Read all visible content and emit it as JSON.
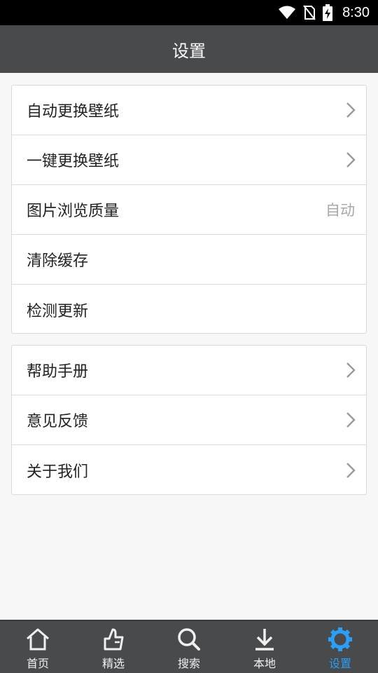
{
  "status_bar": {
    "time": "8:30",
    "icons": [
      "wifi-icon",
      "no-sim-icon",
      "battery-charging-icon"
    ]
  },
  "header": {
    "title": "设置"
  },
  "groups": [
    {
      "items": [
        {
          "label": "自动更换壁纸",
          "has_arrow": true
        },
        {
          "label": "一键更换壁纸",
          "has_arrow": true
        },
        {
          "label": "图片浏览质量",
          "value": "自动"
        },
        {
          "label": "清除缓存"
        },
        {
          "label": "检测更新"
        }
      ]
    },
    {
      "items": [
        {
          "label": "帮助手册",
          "has_arrow": true
        },
        {
          "label": "意见反馈",
          "has_arrow": true
        },
        {
          "label": "关于我们",
          "has_arrow": true
        }
      ]
    }
  ],
  "bottom_nav": {
    "items": [
      {
        "label": "首页",
        "icon": "home-icon"
      },
      {
        "label": "精选",
        "icon": "thumb-up-icon"
      },
      {
        "label": "搜索",
        "icon": "search-icon"
      },
      {
        "label": "本地",
        "icon": "download-icon"
      },
      {
        "label": "设置",
        "icon": "gear-icon",
        "active": true
      }
    ]
  },
  "colors": {
    "title_bar": "#484a4c",
    "active_tab": "#2a9ff5",
    "background": "#f7f7f7"
  }
}
